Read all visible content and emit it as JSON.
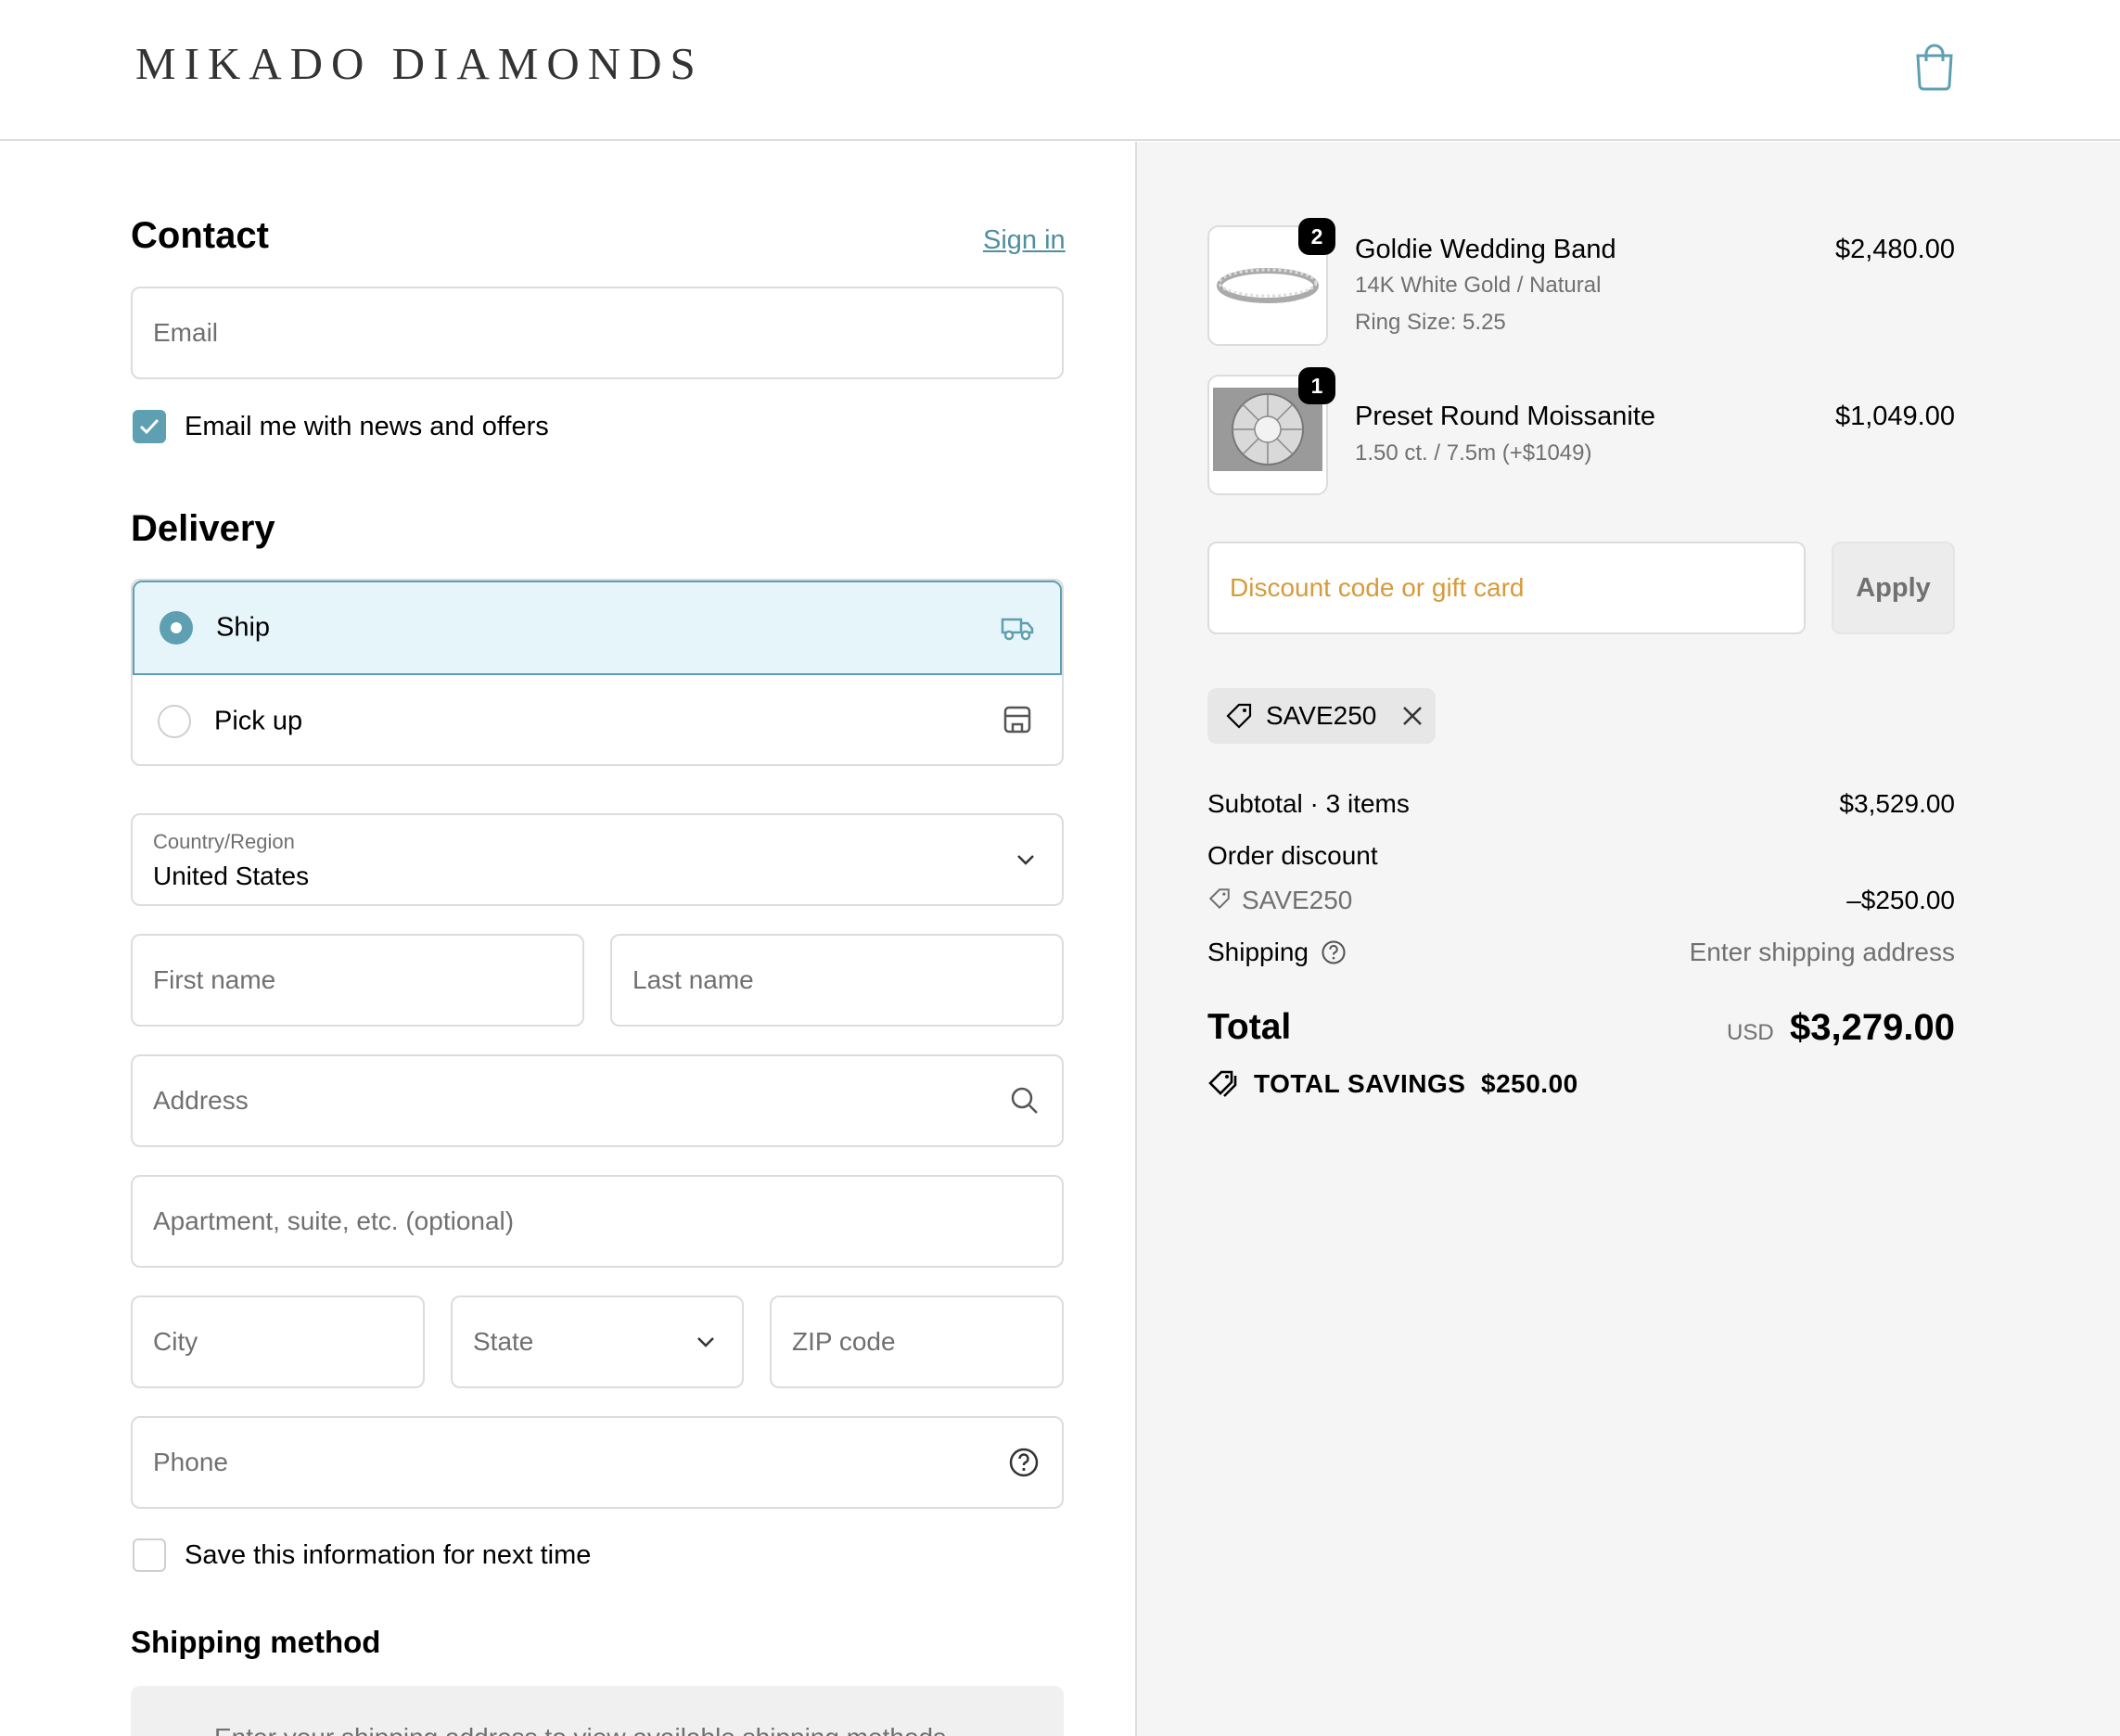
{
  "brand": {
    "logo_text": "MIKADO DIAMONDS"
  },
  "contact": {
    "heading": "Contact",
    "sign_in_label": "Sign in",
    "email_placeholder": "Email",
    "news_checkbox_label": "Email me with news and offers",
    "news_checked": true
  },
  "delivery": {
    "heading": "Delivery",
    "options": [
      {
        "label": "Ship",
        "selected": true
      },
      {
        "label": "Pick up",
        "selected": false
      }
    ],
    "country_label": "Country/Region",
    "country_value": "United States",
    "first_name_placeholder": "First name",
    "last_name_placeholder": "Last name",
    "address_placeholder": "Address",
    "apartment_placeholder": "Apartment, suite, etc. (optional)",
    "city_placeholder": "City",
    "state_placeholder": "State",
    "zip_placeholder": "ZIP code",
    "phone_placeholder": "Phone",
    "save_info_label": "Save this information for next time",
    "save_info_checked": false
  },
  "shipping_method": {
    "heading": "Shipping method",
    "notice": "Enter your shipping address to view available shipping methods."
  },
  "cart": {
    "items": [
      {
        "name": "Goldie Wedding Band",
        "variant": "14K White Gold / Natural",
        "extra": "Ring Size: 5.25",
        "quantity": "2",
        "price": "$2,480.00"
      },
      {
        "name": "Preset Round Moissanite",
        "variant": "1.50 ct. / 7.5m (+$1049)",
        "quantity": "1",
        "price": "$1,049.00"
      }
    ],
    "discount_placeholder": "Discount code or gift card",
    "apply_label": "Apply",
    "applied_code": "SAVE250",
    "subtotal_label": "Subtotal · 3 items",
    "subtotal_value": "$3,529.00",
    "order_discount_label": "Order discount",
    "discount_code": "SAVE250",
    "discount_value": "–$250.00",
    "shipping_label": "Shipping",
    "shipping_value": "Enter shipping address",
    "total_label": "Total",
    "currency": "USD",
    "total_value": "$3,279.00",
    "savings_label": "TOTAL SAVINGS",
    "savings_value": "$250.00"
  },
  "colors": {
    "accent": "#5e9fb1",
    "discount_placeholder": "#d89a3a",
    "right_bg": "#f5f5f5"
  }
}
